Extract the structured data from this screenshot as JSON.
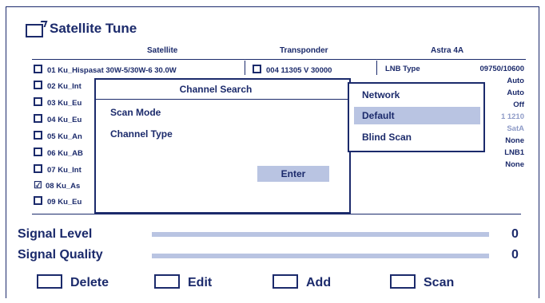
{
  "header": {
    "title": "Satellite Tune"
  },
  "columns": {
    "satellite": "Satellite",
    "transponder": "Transponder",
    "satellite_name": "Astra 4A"
  },
  "satellite_list": [
    {
      "label": "01 Ku_Hispasat 30W-5/30W-6 30.0W",
      "checked": false
    },
    {
      "label": "02 Ku_Int",
      "checked": false
    },
    {
      "label": "03 Ku_Eu",
      "checked": false
    },
    {
      "label": "04 Ku_Eu",
      "checked": false
    },
    {
      "label": "05 Ku_An",
      "checked": false
    },
    {
      "label": "06 Ku_AB",
      "checked": false
    },
    {
      "label": "07 Ku_Int",
      "checked": false
    },
    {
      "label": "08 Ku_As",
      "checked": true
    },
    {
      "label": "09 Ku_Eu",
      "checked": false
    }
  ],
  "transponder": {
    "label": "004 11305 V 30000"
  },
  "params": {
    "lnb_type_label": "LNB Type",
    "lnb_type_value": "09750/10600",
    "values": [
      "Auto",
      "Auto",
      "Off",
      "1 1210",
      "SatA",
      "None",
      "LNB1",
      "None"
    ]
  },
  "dialog": {
    "title": "Channel Search",
    "scan_mode_label": "Scan Mode",
    "channel_type_label": "Channel Type",
    "enter_label": "Enter"
  },
  "dropdown": {
    "options": [
      "Network",
      "Default",
      "Blind Scan"
    ],
    "selected": "Default"
  },
  "signal": {
    "level_label": "Signal Level",
    "level_value": "0",
    "quality_label": "Signal Quality",
    "quality_value": "0"
  },
  "footer_buttons": {
    "delete": "Delete",
    "edit": "Edit",
    "add": "Add",
    "scan": "Scan"
  }
}
